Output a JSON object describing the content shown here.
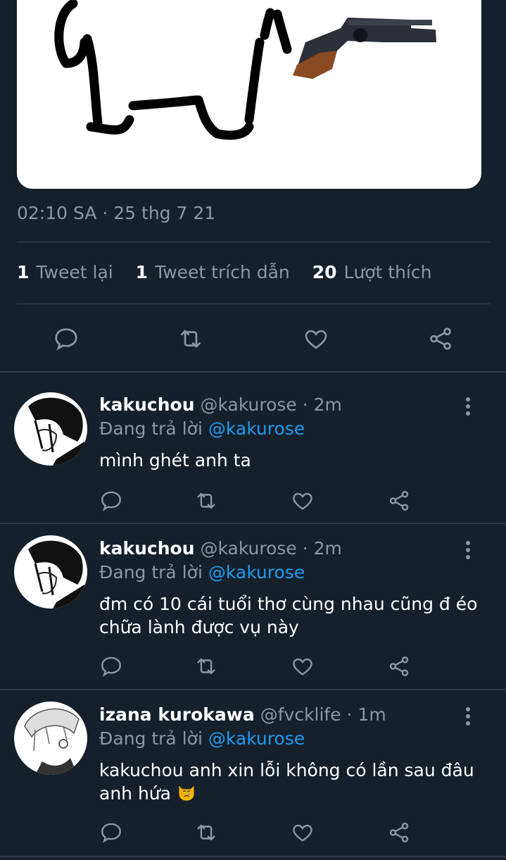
{
  "tweet": {
    "timestamp": "02:10 SA · 25 thg 7 21",
    "stats": {
      "retweets_count": "1",
      "retweets_label": "Tweet lại",
      "quotes_count": "1",
      "quotes_label": "Tweet trích dẫn",
      "likes_count": "20",
      "likes_label": "Lượt thích"
    }
  },
  "replies": [
    {
      "name": "kakuchou",
      "handle": "@kakurose · 2m",
      "replying_label": "Đang trả lời",
      "mention": "@kakurose",
      "text": "mình ghét anh ta"
    },
    {
      "name": "kakuchou",
      "handle": "@kakurose · 2m",
      "replying_label": "Đang trả lời",
      "mention": "@kakurose",
      "text_line1": "đm có 10 cái tuổi thơ cùng nhau cũng đ éo",
      "text_line2": "chữa lành được vụ này"
    },
    {
      "name": "izana kurokawa",
      "handle": "@fvcklife · 1m",
      "replying_label": "Đang trả lời",
      "mention": "@kakurose",
      "text_line1": "kakuchou anh xin lỗi không có lần sau đâu",
      "text_line2": "anh hứa",
      "emoji": "crying-cat-emoji"
    }
  ],
  "colors": {
    "background": "#15202b",
    "secondary_text": "#8b98a5",
    "link": "#1d9bf0",
    "divider": "#38444d"
  },
  "icons": [
    "reply-icon",
    "retweet-icon",
    "like-icon",
    "share-icon",
    "more-icon"
  ]
}
